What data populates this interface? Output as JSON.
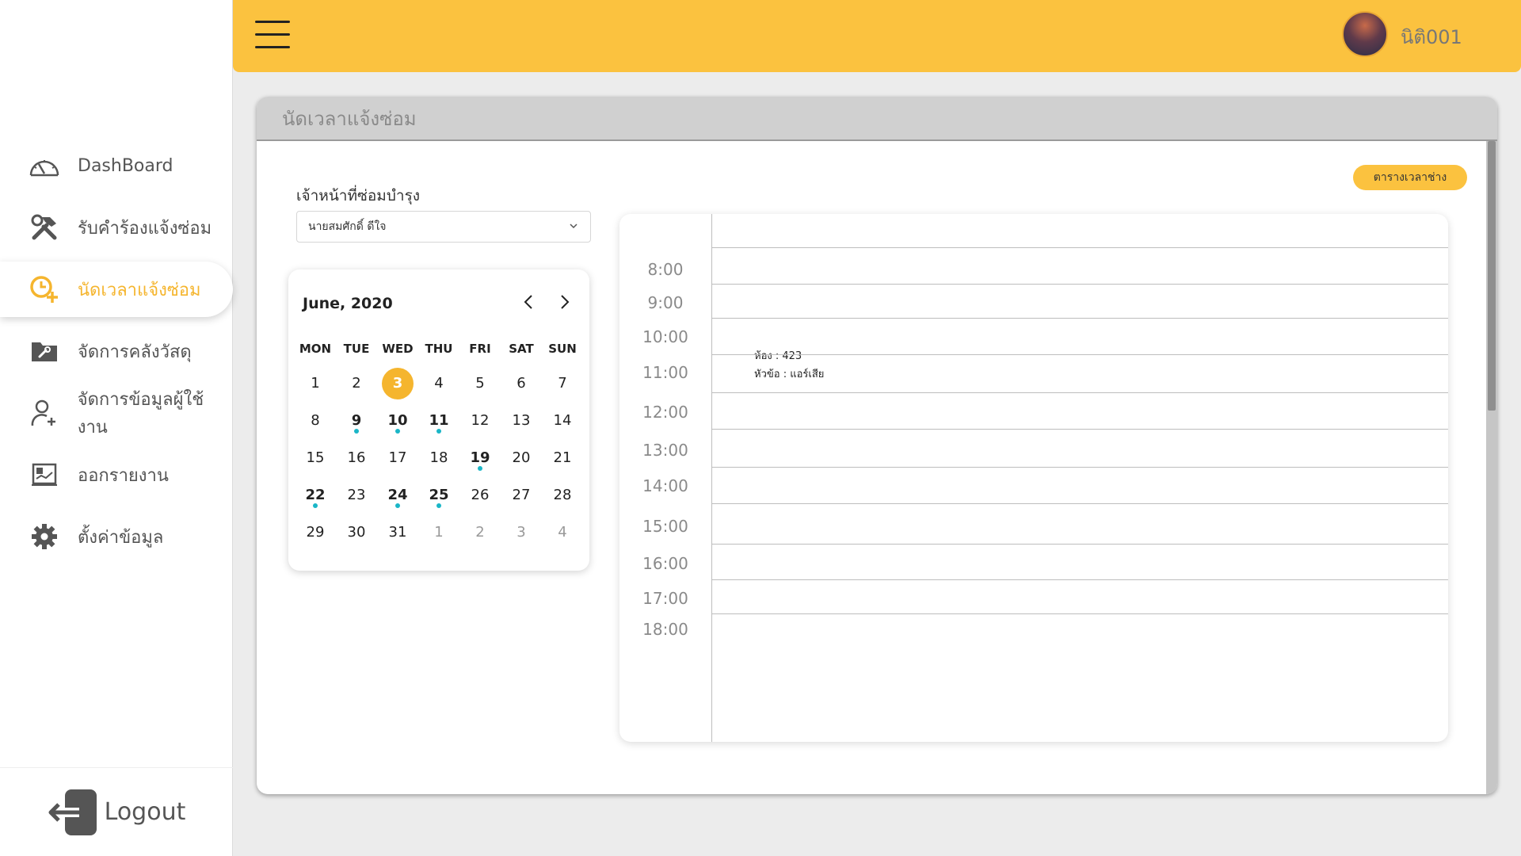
{
  "sidebar": {
    "items": [
      {
        "label": "DashBoard",
        "icon": "dashboard-icon"
      },
      {
        "label": "รับคำร้องแจ้งซ่อม",
        "icon": "tools-icon"
      },
      {
        "label": "นัดเวลาแจ้งซ่อม",
        "icon": "clock-add-icon",
        "active": true
      },
      {
        "label": "จัดการคลังวัสดุ",
        "icon": "folder-wrench-icon"
      },
      {
        "label": "จัดการข้อมูลผู้ใช้งาน",
        "icon": "user-add-icon"
      },
      {
        "label": "ออกรายงาน",
        "icon": "report-icon"
      },
      {
        "label": "ตั้งค่าข้อมูล",
        "icon": "gear-icon"
      }
    ],
    "logout_label": "Logout"
  },
  "header": {
    "username": "นิติ001",
    "accent": "#fbc23f"
  },
  "page": {
    "title": "นัดเวลาแจ้งซ่อม",
    "schedule_button": "ตารางเวลาช่าง",
    "technician_label": "เจ้าหน้าที่ซ่อมบำรุง",
    "technician_selected": "นายสมศักดิ์ ดีใจ"
  },
  "calendar": {
    "month_label": "June, 2020",
    "weekdays": [
      "MON",
      "TUE",
      "WED",
      "THU",
      "FRI",
      "SAT",
      "SUN"
    ],
    "weeks": [
      [
        {
          "d": "1"
        },
        {
          "d": "2"
        },
        {
          "d": "3",
          "sel": true
        },
        {
          "d": "4"
        },
        {
          "d": "5"
        },
        {
          "d": "6"
        },
        {
          "d": "7"
        }
      ],
      [
        {
          "d": "8"
        },
        {
          "d": "9",
          "ev": true
        },
        {
          "d": "10",
          "ev": true
        },
        {
          "d": "11",
          "ev": true
        },
        {
          "d": "12"
        },
        {
          "d": "13"
        },
        {
          "d": "14"
        }
      ],
      [
        {
          "d": "15"
        },
        {
          "d": "16"
        },
        {
          "d": "17"
        },
        {
          "d": "18"
        },
        {
          "d": "19",
          "ev": true
        },
        {
          "d": "20"
        },
        {
          "d": "21"
        }
      ],
      [
        {
          "d": "22",
          "ev": true
        },
        {
          "d": "23"
        },
        {
          "d": "24",
          "ev": true
        },
        {
          "d": "25",
          "ev": true
        },
        {
          "d": "26"
        },
        {
          "d": "27"
        },
        {
          "d": "28"
        }
      ],
      [
        {
          "d": "29"
        },
        {
          "d": "30"
        },
        {
          "d": "31"
        },
        {
          "d": "1",
          "muted": true
        },
        {
          "d": "2",
          "muted": true
        },
        {
          "d": "3",
          "muted": true
        },
        {
          "d": "4",
          "muted": true
        }
      ]
    ]
  },
  "timeline": {
    "times": [
      "8:00",
      "9:00",
      "10:00",
      "11:00",
      "12:00",
      "13:00",
      "14:00",
      "15:00",
      "16:00",
      "17:00",
      "18:00"
    ],
    "event": {
      "room": "ห้อง : 423",
      "topic": "หัวข้อ : แอร์เสีย"
    }
  }
}
